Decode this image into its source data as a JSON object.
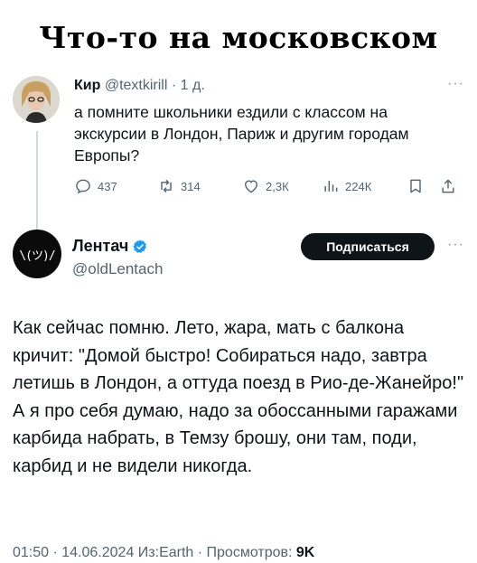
{
  "meme_title": "Что-то на московском",
  "tweet1": {
    "name": "Кир",
    "handle": "@textkirill",
    "separator": "·",
    "time": "1 д.",
    "more": "···",
    "text": "а помните школьники ездили с классом на экскурсии в Лондон, Париж и другим городам Европы?",
    "actions": {
      "replies": "437",
      "retweets": "314",
      "likes": "2,3К",
      "views": "224К"
    },
    "icons": [
      "reply-icon",
      "retweet-icon",
      "like-icon",
      "views-icon",
      "bookmark-icon",
      "share-icon"
    ]
  },
  "tweet2": {
    "name": "Лентач",
    "handle": "@oldLentach",
    "avatar_text": "\\(ツ)/",
    "follow_label": "Подписаться",
    "more": "···",
    "text": "Как сейчас помню. Лето, жара, мать с балкона кричит: \"Домой быстро! Собираться надо, завтра летишь в Лондон, а оттуда поезд в Рио-де-Жанейро!\" А я про себя думаю, надо за обоссанными гаражами карбида набрать, в Темзу брошу, они там, поди, карбид и не видели никогда.",
    "meta": "01:50 · 14.06.2024 Из:Earth · Просмотров: ",
    "views": "9K",
    "verified_color": "#1d9bf0"
  }
}
